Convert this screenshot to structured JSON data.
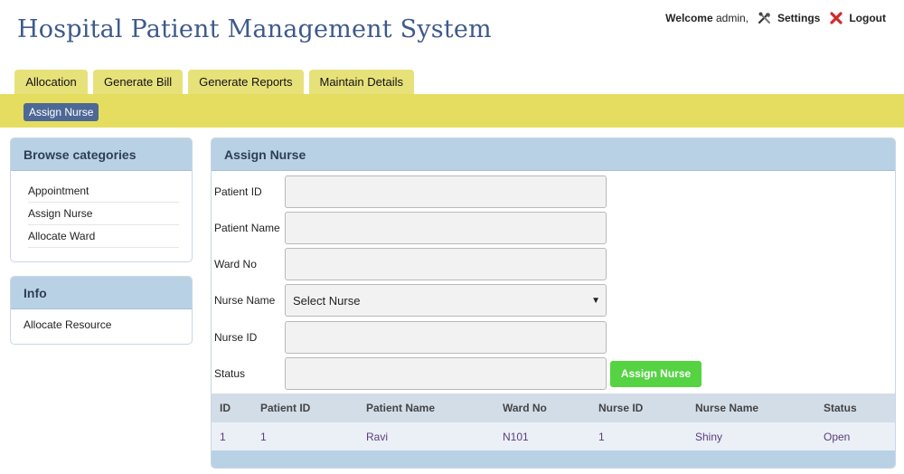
{
  "app": {
    "title": "Hospital Patient Management System"
  },
  "user_bar": {
    "welcome_label": "Welcome",
    "username": "admin,",
    "settings_label": "Settings",
    "logout_label": "Logout"
  },
  "tabs": [
    {
      "label": "Allocation"
    },
    {
      "label": "Generate Bill"
    },
    {
      "label": "Generate Reports"
    },
    {
      "label": "Maintain Details"
    }
  ],
  "subnav": {
    "active_label": "Assign Nurse"
  },
  "sidebar": {
    "browse_title": "Browse categories",
    "items": [
      {
        "label": "Appointment"
      },
      {
        "label": "Assign Nurse"
      },
      {
        "label": "Allocate Ward"
      }
    ],
    "info_title": "Info",
    "info_items": [
      {
        "label": "Allocate Resource"
      }
    ]
  },
  "form": {
    "title": "Assign Nurse",
    "patient_id_label": "Patient ID",
    "patient_name_label": "Patient Name",
    "ward_no_label": "Ward No",
    "nurse_name_label": "Nurse Name",
    "nurse_name_selected": "Select Nurse",
    "nurse_id_label": "Nurse ID",
    "status_label": "Status",
    "submit_label": "Assign Nurse"
  },
  "table": {
    "headers": [
      "ID",
      "Patient ID",
      "Patient Name",
      "Ward No",
      "Nurse ID",
      "Nurse Name",
      "Status"
    ],
    "rows": [
      [
        "1",
        "1",
        "Ravi",
        "N101",
        "1",
        "Shiny",
        "Open"
      ]
    ]
  },
  "colors": {
    "title": "#3e5a8a",
    "tab": "#e7e17a",
    "subbar": "#e5dd5f",
    "panel_header": "#b9d1e5",
    "button": "#55d343",
    "pill": "#4d6896"
  },
  "icons": {
    "settings": "tools-icon",
    "logout": "close-x-icon"
  }
}
